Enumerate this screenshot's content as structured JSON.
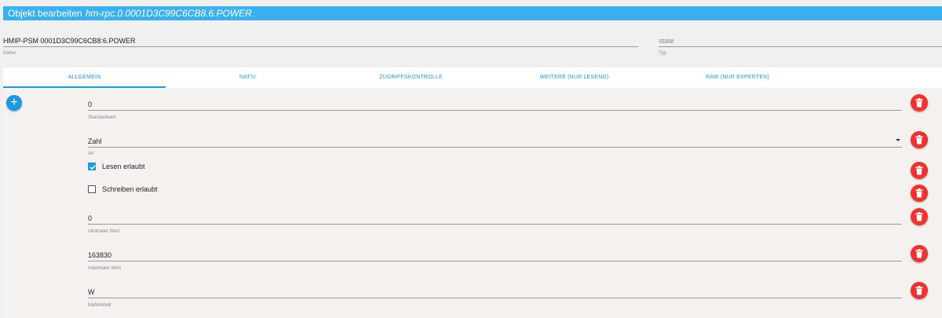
{
  "header": {
    "prefix": "Objekt bearbeiten",
    "object_id": "hm-rpc.0.0001D3C99C6CB8.6.POWER"
  },
  "name_field": {
    "value": "HMIP-PSM 0001D3C99C6CB8:6.POWER",
    "label": "Name"
  },
  "type_field": {
    "value": "state",
    "label": "Typ"
  },
  "tabs": [
    {
      "label": "ALLGEMEIN",
      "active": true
    },
    {
      "label": "NATIV"
    },
    {
      "label": "ZUGRIFFSKONTROLLE"
    },
    {
      "label": "WEITERE (NUR LESEND)"
    },
    {
      "label": "RAW (NUR EXPERTEN)"
    }
  ],
  "fields": {
    "default_value": {
      "value": "0",
      "label": "Standardwert"
    },
    "type": {
      "value": "Zahl",
      "label": "Art"
    },
    "read": {
      "label": "Lesen erlaubt",
      "checked": true
    },
    "write": {
      "label": "Schreiben erlaubt",
      "checked": false
    },
    "min": {
      "value": "0",
      "label": "minimaler Wert"
    },
    "max": {
      "value": "163830",
      "label": "maximaler Wert"
    },
    "unit": {
      "value": "W",
      "label": "Maßeinheit"
    }
  },
  "add_button": {
    "icon": "plus-icon",
    "glyph": "+"
  },
  "colors": {
    "accent": "#1a9ae0",
    "header": "#3ab0f0",
    "danger": "#f0312e"
  }
}
